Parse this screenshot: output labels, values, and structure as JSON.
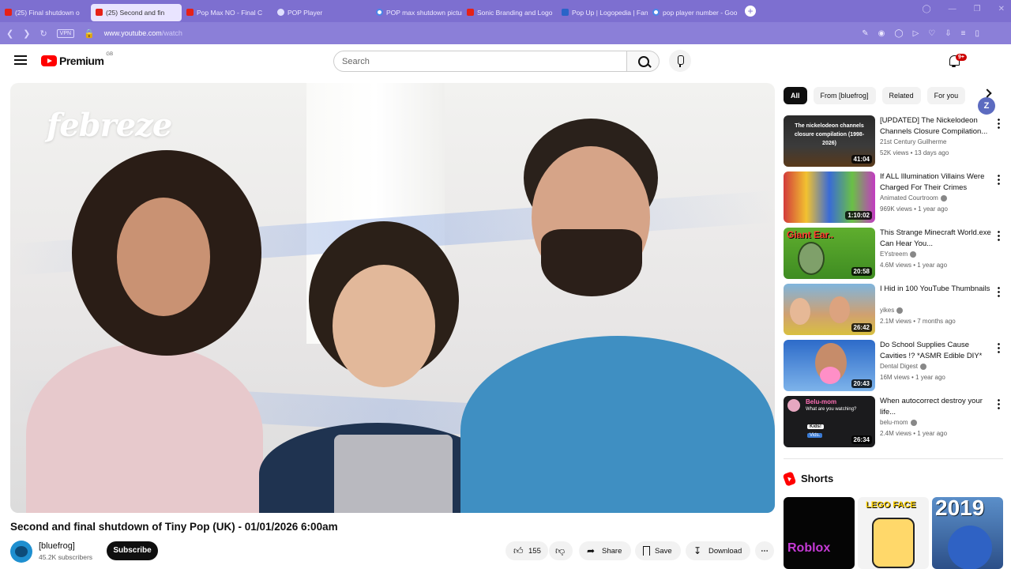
{
  "browser": {
    "tabs": [
      {
        "label": "(25) Final shutdown o",
        "icon": "youtube-favicon",
        "active": false
      },
      {
        "label": "(25) Second and fin",
        "icon": "youtube-favicon",
        "active": true
      },
      {
        "label": "Pop Max NO - Final C",
        "icon": "youtube-favicon",
        "active": false
      },
      {
        "label": "POP Player",
        "icon": "pop-favicon",
        "active": false
      },
      {
        "label": "POP max shutdown pictur",
        "icon": "google-favicon",
        "active": false
      },
      {
        "label": "Sonic Branding and Logo",
        "icon": "youtube-favicon",
        "active": false
      },
      {
        "label": "Pop Up | Logopedia | Fan",
        "icon": "logopedia-favicon",
        "active": false
      },
      {
        "label": "pop player number - Goo",
        "icon": "google-favicon",
        "active": false
      }
    ],
    "new_tab": "+",
    "vpn": "VPN",
    "url_domain": "www.youtube.com",
    "url_path": "/watch"
  },
  "header": {
    "logo_text": "Premium",
    "logo_region": "GB",
    "search_placeholder": "Search",
    "notifications_badge": "9+",
    "avatar_letter": "Z"
  },
  "player": {
    "overlay_logo": "febreze"
  },
  "video": {
    "title": "Second and final shutdown of Tiny Pop (UK) - 01/01/2026 6:00am",
    "channel_name": "[bluefrog]",
    "subscribers": "45.2K subscribers",
    "subscribe_label": "Subscribe",
    "like_count": "155",
    "share_label": "Share",
    "save_label": "Save",
    "download_label": "Download"
  },
  "chips": [
    "All",
    "From [bluefrog]",
    "Related",
    "For you"
  ],
  "recommendations": [
    {
      "title": "[UPDATED] The Nickelodeon Channels Closure Compilation...",
      "channel": "21st Century Guilherme",
      "verified": false,
      "meta": "52K views • 13 days ago",
      "duration": "41:04",
      "thumb_text": "The nickelodeon channels closure compilation (1998-2026)"
    },
    {
      "title": "If ALL Illumination Villains Were Charged For Their Crimes",
      "channel": "Animated Courtroom",
      "verified": true,
      "meta": "969K views • 1 year ago",
      "duration": "1:10:02",
      "thumb_text": ""
    },
    {
      "title": "This Strange Minecraft World.exe Can Hear You...",
      "channel": "EYstreem",
      "verified": true,
      "meta": "4.6M views • 1 year ago",
      "duration": "20:58",
      "thumb_text": "Giant Ear.."
    },
    {
      "title": "I Hid in 100 YouTube Thumbnails",
      "channel": "yikes",
      "verified": true,
      "meta": "2.1M views • 7 months ago",
      "duration": "26:42",
      "thumb_text": ""
    },
    {
      "title": "Do School Supplies Cause Cavities !? *ASMR Edible DIY*",
      "channel": "Dental Digest",
      "verified": true,
      "meta": "16M views • 1 year ago",
      "duration": "20:43",
      "thumb_text": ""
    },
    {
      "title": "When autocorrect destroy your life...",
      "channel": "belu-mom",
      "verified": true,
      "meta": "2.4M views • 1 year ago",
      "duration": "26:34",
      "thumb_text": "Belu-mom",
      "thumb_sub": "What are you watching?",
      "thumb_kids": "Kids!",
      "thumb_vids": "Vids."
    }
  ],
  "shorts": {
    "title": "Shorts",
    "items": [
      {
        "text": "Roblox"
      },
      {
        "text": "LEGO FACE"
      },
      {
        "text": "2019"
      }
    ]
  },
  "colors": {
    "browser_tabbar": "#7d6fd0",
    "youtube_red": "#ff0000",
    "subscribe_bg": "#0f0f0f"
  }
}
